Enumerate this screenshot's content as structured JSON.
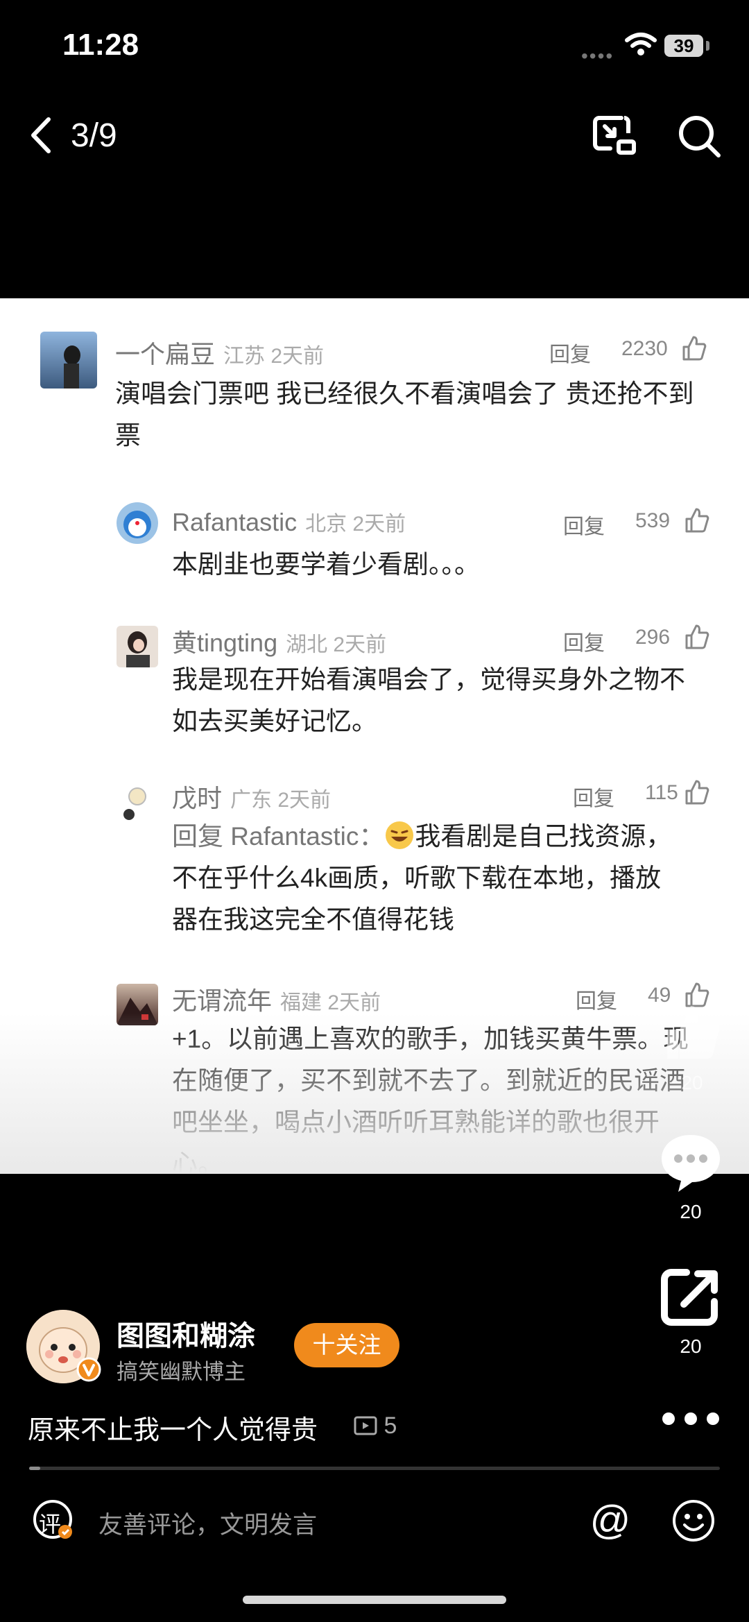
{
  "status": {
    "time": "11:28",
    "battery": "39"
  },
  "nav": {
    "page_counter": "3/9"
  },
  "comments": [
    {
      "user": "一个扁豆",
      "location": "江苏 2天前",
      "reply": "回复",
      "likes": "2230",
      "text": "演唱会门票吧 我已经很久不看演唱会了 贵还抢不到票"
    },
    {
      "user": "Rafantastic",
      "location": "北京 2天前",
      "reply": "回复",
      "likes": "539",
      "text": "本剧韭也要学着少看剧。。。"
    },
    {
      "user": "黄tingting",
      "location": "湖北 2天前",
      "reply": "回复",
      "likes": "296",
      "text": "我是现在开始看演唱会了，觉得买身外之物不如去买美好记忆。"
    },
    {
      "user": "戊时",
      "location": "广东 2天前",
      "reply": "回复",
      "likes": "115",
      "text_prefix": "回复 Rafantastic：",
      "text": "我看剧是自己找资源，不在乎什么4k画质，听歌下载在本地，播放器在我这完全不值得花钱"
    },
    {
      "user": "无谓流年",
      "location": "福建 2天前",
      "reply": "回复",
      "likes": "49",
      "text": "+1。以前遇上喜欢的歌手，加钱买黄牛票。现在随便了，买不到就不去了。到就近的民谣酒吧坐坐，喝点小酒听听耳熟能详的歌也很开心。"
    }
  ],
  "rail": {
    "like_count": "20",
    "comment_count": "20",
    "share_count": "20"
  },
  "author": {
    "name": "图图和糊涂",
    "desc": "搞笑幽默博主",
    "follow_label": "十关注"
  },
  "post": {
    "caption": "原来不止我一个人觉得贵",
    "image_count": "5",
    "progress": 0.01
  },
  "composer": {
    "icon_label": "评",
    "placeholder": "友善评论，文明发言",
    "at_symbol": "@"
  },
  "colors": {
    "accent": "#f08a1c",
    "background": "#000000"
  }
}
